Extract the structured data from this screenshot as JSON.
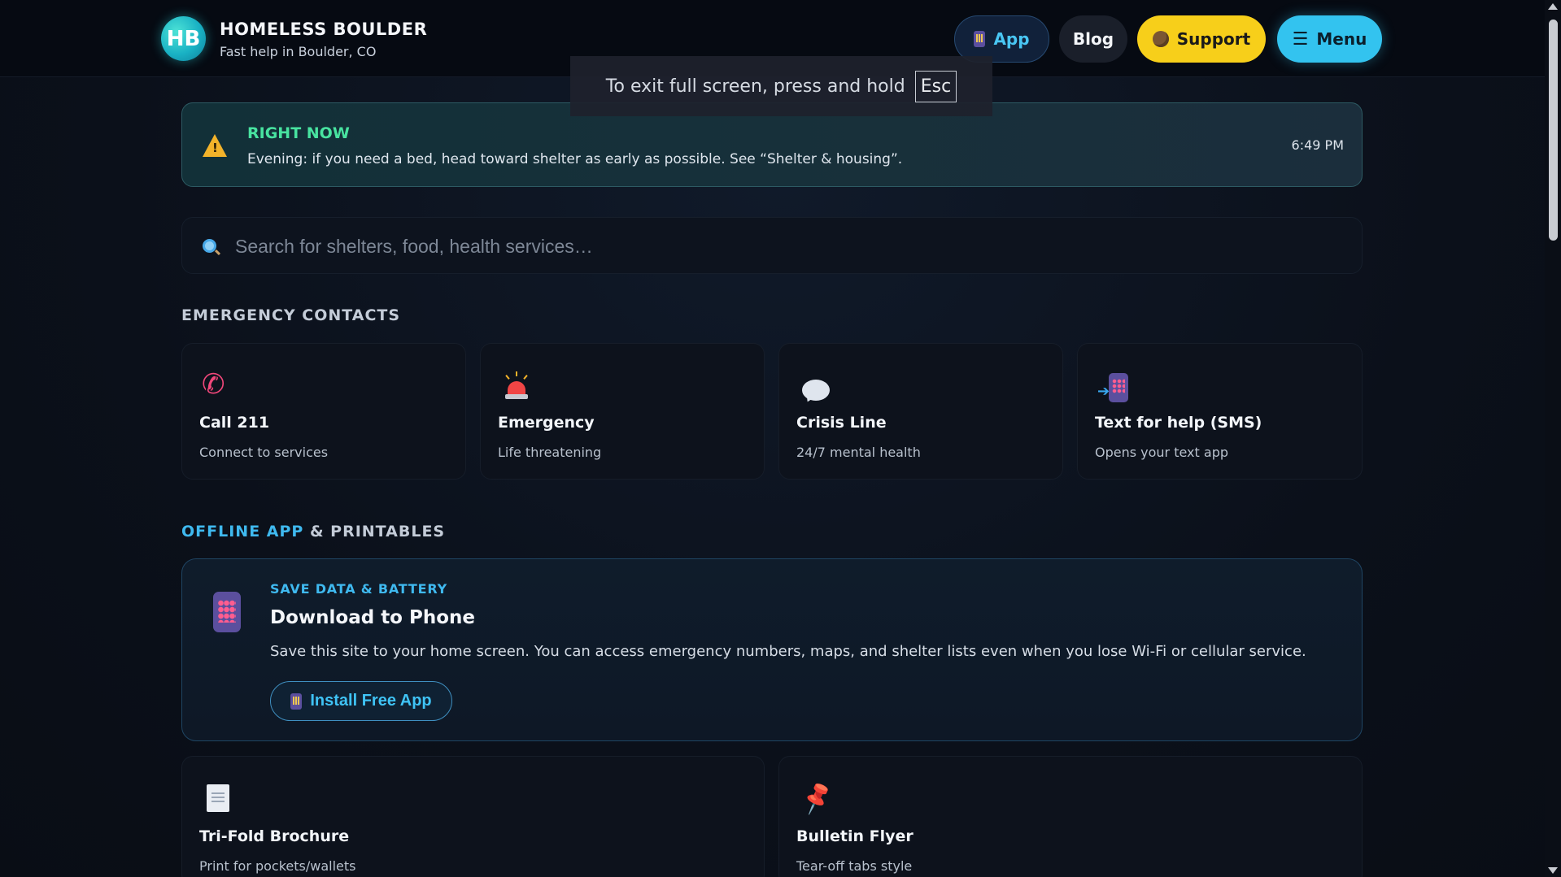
{
  "header": {
    "logo_initials": "HB",
    "title": "HOMELESS BOULDER",
    "subtitle": "Fast help in Boulder, CO",
    "nav": {
      "app_label": "App",
      "blog_label": "Blog",
      "support_label": "Support",
      "menu_label": "Menu"
    }
  },
  "fullscreen_notice": {
    "text": "To exit full screen, press and hold",
    "key": "Esc"
  },
  "alert": {
    "title": "RIGHT NOW",
    "message": "Evening: if you need a bed, head toward shelter as early as possible. See “Shelter & housing”.",
    "time": "6:49 PM"
  },
  "search": {
    "placeholder": "Search for shelters, food, health services…",
    "value": ""
  },
  "emergency": {
    "heading": "EMERGENCY CONTACTS",
    "cards": [
      {
        "title": "Call 211",
        "subtitle": "Connect to services",
        "icon": "phone-icon"
      },
      {
        "title": "Emergency",
        "subtitle": "Life threatening",
        "icon": "siren-icon"
      },
      {
        "title": "Crisis Line",
        "subtitle": "24/7 mental health",
        "icon": "speech-bubble-icon"
      },
      {
        "title": "Text for help (SMS)",
        "subtitle": "Opens your text app",
        "icon": "mobile-arrow-icon"
      }
    ]
  },
  "offline": {
    "heading_accent": "OFFLINE APP",
    "heading_rest": " & PRINTABLES",
    "promo": {
      "eyebrow": "SAVE DATA & BATTERY",
      "title": "Download to Phone",
      "text": "Save this site to your home screen. You can access emergency numbers, maps, and shelter lists even when you lose Wi-Fi or cellular service.",
      "button_label": "Install Free App"
    },
    "printables": [
      {
        "title": "Tri-Fold Brochure",
        "subtitle": "Print for pockets/wallets",
        "icon": "document-icon"
      },
      {
        "title": "Bulletin Flyer",
        "subtitle": "Tear-off tabs style",
        "icon": "pushpin-icon"
      }
    ]
  },
  "colors": {
    "accent_cyan": "#3fb9ef",
    "alert_green": "#48e3a0",
    "support_yellow": "#f7cf1a",
    "background": "#0b101a"
  }
}
